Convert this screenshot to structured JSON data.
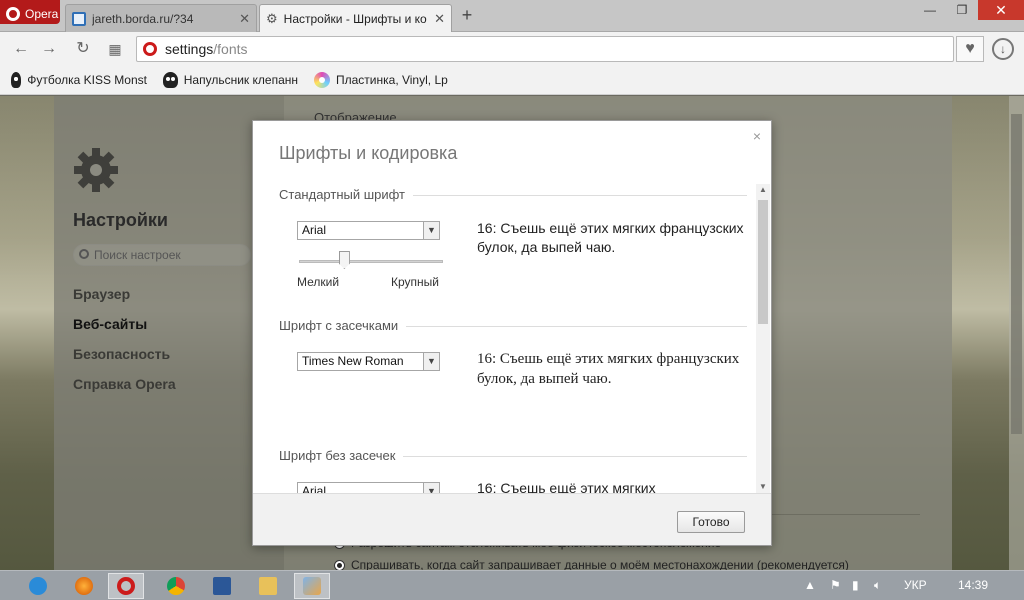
{
  "browser": {
    "menu_label": "Opera",
    "tabs": [
      {
        "label": "jareth.borda.ru/?34",
        "active": false
      },
      {
        "label": "Настройки - Шрифты и ко",
        "active": true
      }
    ],
    "new_tab": "+",
    "window": {
      "minimize": "—",
      "maximize": "❐",
      "close": "✕"
    },
    "address": {
      "prefix": "settings",
      "path": "/fonts"
    },
    "bookmarks": [
      {
        "label": "Футболка KISS Monst",
        "icon": "skull-icon"
      },
      {
        "label": "Напульсник клепанн",
        "icon": "skull-icon"
      },
      {
        "label": "Пластинка, Vinyl, Lp",
        "icon": "disc-icon"
      }
    ]
  },
  "settings": {
    "title": "Настройки",
    "search_placeholder": "Поиск настроек",
    "nav": [
      {
        "label": "Браузер",
        "selected": false
      },
      {
        "label": "Веб-сайты",
        "selected": true
      },
      {
        "label": "Безопасность",
        "selected": false
      },
      {
        "label": "Справка Opera",
        "selected": false
      }
    ],
    "main": {
      "section_display": "Отображение",
      "radio_1": "Разрешить сайтам отслеживать моё физическое местоположение",
      "radio_2": "Спрашивать, когда сайт запрашивает данные о моём местонахождении (рекомендуется)"
    }
  },
  "dialog": {
    "title": "Шрифты и кодировка",
    "close": "×",
    "standard": {
      "title": "Стандартный шрифт",
      "font": "Arial",
      "sample": "16: Съешь ещё этих мягких французских булок, да выпей чаю.",
      "size_small": "Мелкий",
      "size_large": "Крупный",
      "size_level": 0.3
    },
    "serif": {
      "title": "Шрифт с засечками",
      "font": "Times New Roman",
      "sample": "16: Съешь ещё этих мягких французских булок, да выпей чаю."
    },
    "sans": {
      "title": "Шрифт без засечек",
      "font": "Arial",
      "sample": "16: Съешь ещё этих мягких"
    },
    "done": "Готово"
  },
  "taskbar": {
    "language": "УКР",
    "time": "14:39",
    "apps": [
      "ie-icon",
      "firefox-icon",
      "opera-icon",
      "chrome-icon",
      "word-icon",
      "folder-icon",
      "control-panel-icon"
    ]
  },
  "colors": {
    "opera_red": "#b31a1a",
    "accent_blue": "#2f6fb6"
  }
}
